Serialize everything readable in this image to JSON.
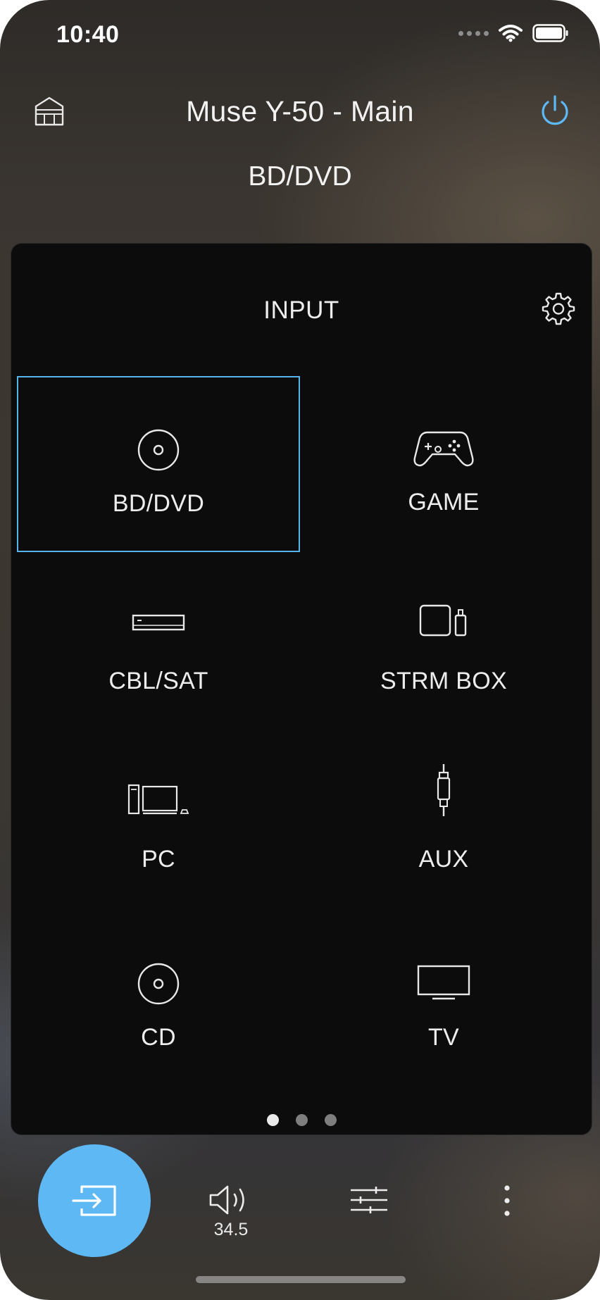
{
  "status_bar": {
    "time": "10:40",
    "icons": [
      "cellular-signal-icon",
      "wifi-icon",
      "battery-icon"
    ]
  },
  "header": {
    "home_icon": "home-icon",
    "title": "Muse Y-50 - Main",
    "power_icon": "power-icon",
    "current_input": "BD/DVD"
  },
  "input_panel": {
    "title": "INPUT",
    "settings_icon": "gear-icon",
    "inputs": [
      {
        "label": "BD/DVD",
        "icon": "disc-icon",
        "selected": true
      },
      {
        "label": "GAME",
        "icon": "gamepad-icon",
        "selected": false
      },
      {
        "label": "CBL/SAT",
        "icon": "set-top-box-icon",
        "selected": false
      },
      {
        "label": "STRM BOX",
        "icon": "streaming-box-icon",
        "selected": false
      },
      {
        "label": "PC",
        "icon": "computer-icon",
        "selected": false
      },
      {
        "label": "AUX",
        "icon": "audio-jack-icon",
        "selected": false
      },
      {
        "label": "CD",
        "icon": "disc-icon",
        "selected": false
      },
      {
        "label": "TV",
        "icon": "tv-icon",
        "selected": false
      }
    ],
    "pages": {
      "current": 1,
      "total": 3
    }
  },
  "bottom_bar": {
    "input_button_icon": "input-icon",
    "volume_icon": "speaker-icon",
    "volume_value": "34.5",
    "sound_settings_icon": "sliders-icon",
    "more_icon": "more-vertical-icon"
  },
  "colors": {
    "accent": "#5db8f3",
    "selected_border": "#58b4ec",
    "panel_background": "#0c0c0c",
    "text": "#f2f2f2"
  }
}
